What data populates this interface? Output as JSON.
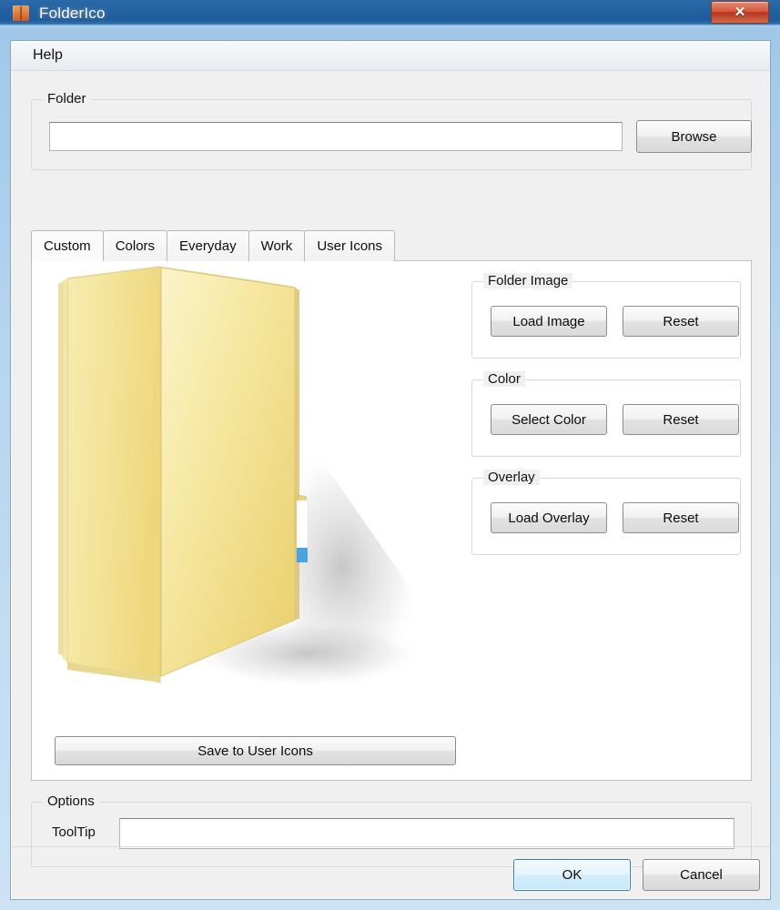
{
  "window": {
    "title": "FolderIco",
    "app_icon": "folder-icon",
    "close_label": "✕",
    "close_icon": "close-icon"
  },
  "menu": {
    "items": [
      {
        "label": "Help"
      }
    ]
  },
  "folder_group": {
    "title": "Folder",
    "path_value": "",
    "path_placeholder": "",
    "browse_label": "Browse"
  },
  "tabs": [
    {
      "label": "Custom",
      "active": true
    },
    {
      "label": "Colors",
      "active": false
    },
    {
      "label": "Everyday",
      "active": false
    },
    {
      "label": "Work",
      "active": false
    },
    {
      "label": "User Icons",
      "active": false
    }
  ],
  "preview": {
    "icon_name": "open-folder-preview",
    "folder_color": "#f5e79e",
    "folder_edge_color": "#e8d27a",
    "label_strip_color": "#ffffff",
    "label_tag_color": "#4aa3e0"
  },
  "panels": [
    {
      "title": "Folder Image",
      "primary_label": "Load Image",
      "reset_label": "Reset"
    },
    {
      "title": "Color",
      "primary_label": "Select Color",
      "reset_label": "Reset"
    },
    {
      "title": "Overlay",
      "primary_label": "Load Overlay",
      "reset_label": "Reset"
    }
  ],
  "save_button_label": "Save to User Icons",
  "options_group": {
    "title": "Options",
    "tooltip_label": "ToolTip",
    "tooltip_value": "",
    "tooltip_placeholder": ""
  },
  "dialog_buttons": {
    "ok_label": "OK",
    "cancel_label": "Cancel"
  },
  "colors": {
    "title_bar": "#215e9f",
    "close_button": "#c2492c",
    "accent": "#3c7fb1",
    "client_bg": "#f0f0f0"
  }
}
